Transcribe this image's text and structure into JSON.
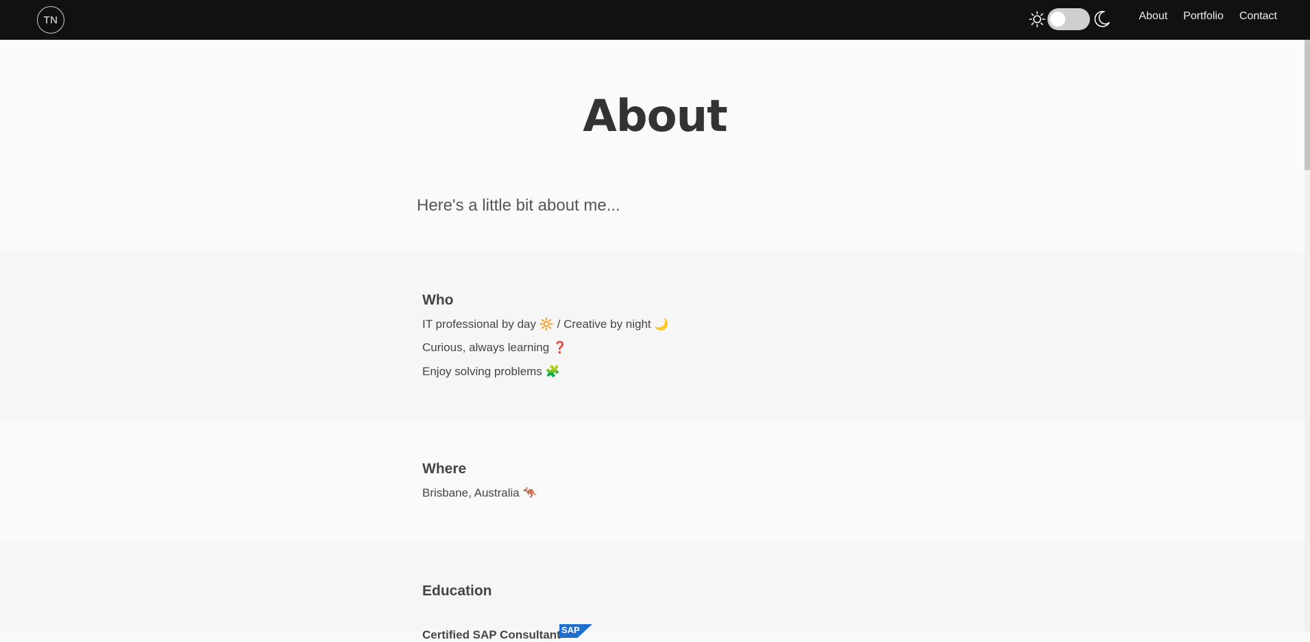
{
  "nav": {
    "logo_text": "TN",
    "links": [
      "About",
      "Portfolio",
      "Contact"
    ]
  },
  "header": {
    "title": "About",
    "subtitle": "Here's a little bit about me..."
  },
  "who": {
    "heading": "Who",
    "lines": [
      {
        "text": "IT professional by day",
        "emoji": "🔆",
        "text2": "/ Creative by night",
        "emoji2": "🌙"
      },
      {
        "text": "Curious, always learning",
        "emoji": "❓"
      },
      {
        "text": "Enjoy solving problems",
        "emoji": "🧩"
      }
    ]
  },
  "where": {
    "heading": "Where",
    "line": "Brisbane, Australia",
    "emoji": "🦘"
  },
  "education": {
    "heading": "Education",
    "cert_partial": "Certified SAP Consultant",
    "badge": "SAP"
  },
  "colors": {
    "navbar_bg": "#111111",
    "page_bg": "#fafafa",
    "section_alt_bg": "#f6f6f6",
    "sap_blue": "#1f6fd1"
  }
}
